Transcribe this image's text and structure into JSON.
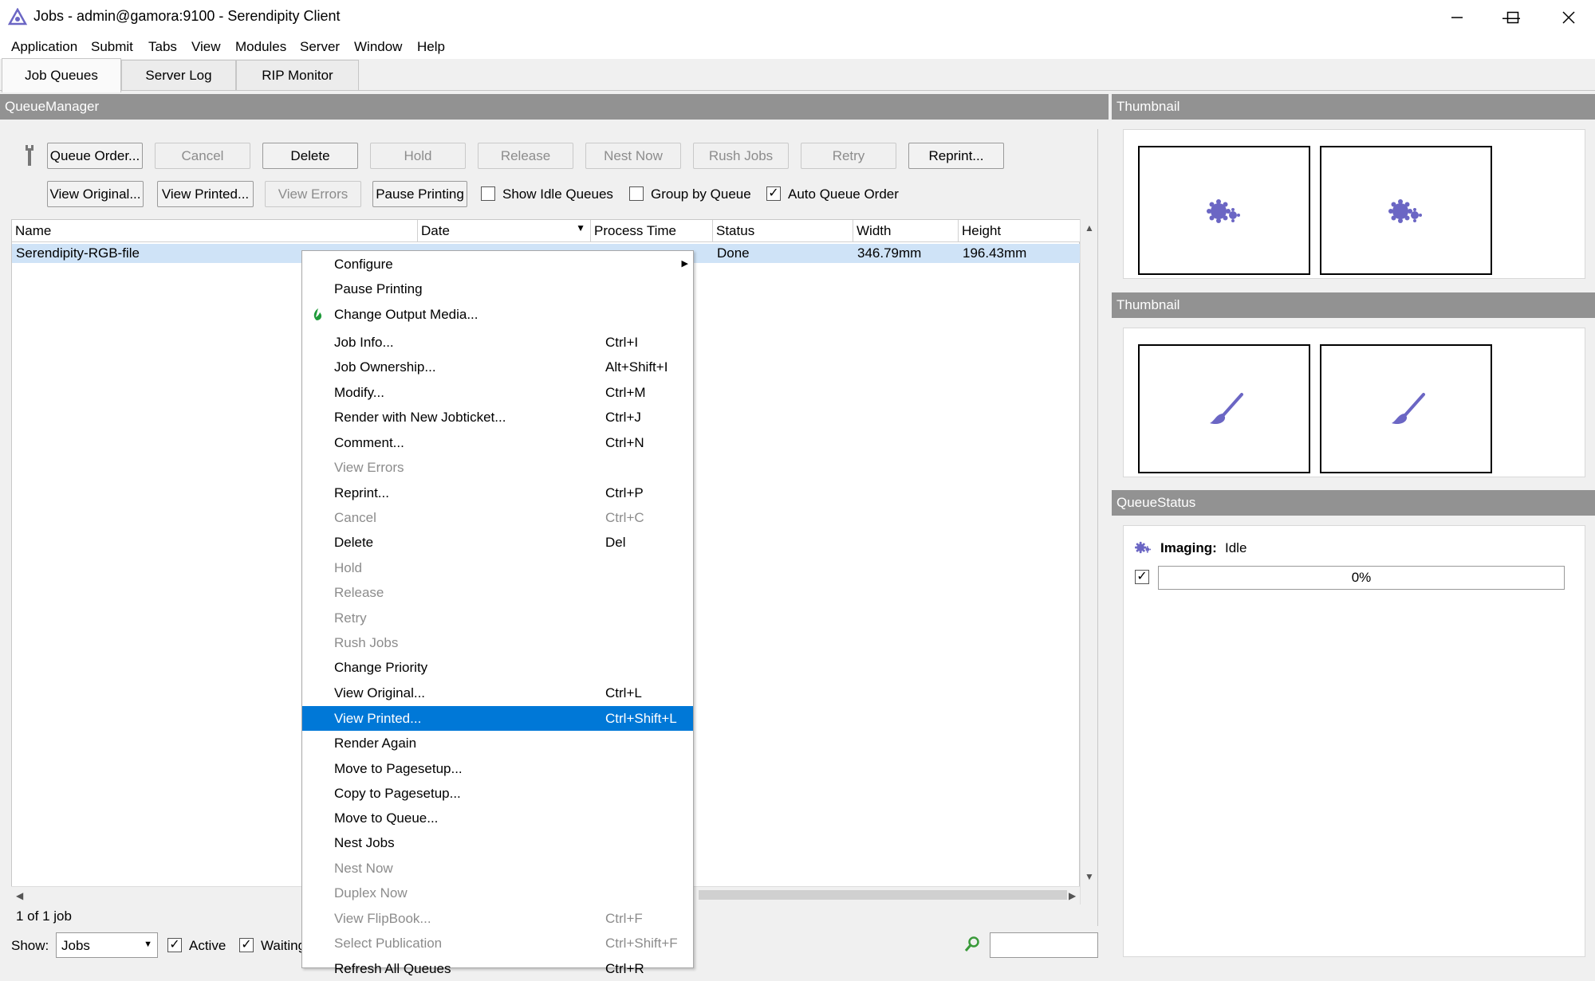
{
  "window": {
    "title": "Jobs - admin@gamora:9100 - Serendipity Client"
  },
  "menubar": [
    "Application",
    "Submit",
    "Tabs",
    "View",
    "Modules",
    "Server",
    "Window",
    "Help"
  ],
  "tabs": [
    "Job Queues",
    "Server Log",
    "RIP Monitor"
  ],
  "queue_manager": {
    "title": "QueueManager",
    "toolbar_row1": [
      {
        "label": "Queue Order...",
        "enabled": true
      },
      {
        "label": "Cancel",
        "enabled": false
      },
      {
        "label": "Delete",
        "enabled": true
      },
      {
        "label": "Hold",
        "enabled": false
      },
      {
        "label": "Release",
        "enabled": false
      },
      {
        "label": "Nest Now",
        "enabled": false
      },
      {
        "label": "Rush Jobs",
        "enabled": false
      },
      {
        "label": "Retry",
        "enabled": false
      },
      {
        "label": "Reprint...",
        "enabled": true
      }
    ],
    "toolbar_row2": [
      {
        "label": "View Original...",
        "enabled": true
      },
      {
        "label": "View Printed...",
        "enabled": true
      },
      {
        "label": "View Errors",
        "enabled": false
      },
      {
        "label": "Pause Printing",
        "enabled": true
      }
    ],
    "options": [
      {
        "label": "Show Idle Queues",
        "checked": false
      },
      {
        "label": "Group by Queue",
        "checked": false
      },
      {
        "label": "Auto Queue Order",
        "checked": true
      }
    ],
    "columns": [
      "Name",
      "Date",
      "Process Time",
      "Status",
      "Width",
      "Height"
    ],
    "rows": [
      {
        "name": "Serendipity-RGB-file",
        "status": "Done",
        "width": "346.79mm",
        "height": "196.43mm"
      }
    ],
    "job_count": "1 of 1 job",
    "show_label": "Show:",
    "show_value": "Jobs",
    "filters": [
      {
        "label": "Active",
        "checked": true
      },
      {
        "label": "Waiting",
        "checked": true
      }
    ]
  },
  "context_menu": [
    {
      "label": "Configure",
      "shortcut": "",
      "enabled": true,
      "submenu": true
    },
    {
      "label": "Pause Printing",
      "shortcut": "",
      "enabled": true
    },
    {
      "label": "Change Output Media...",
      "shortcut": "",
      "enabled": true,
      "icon": "leaf-icon"
    },
    {
      "label": "Job Info...",
      "shortcut": "Ctrl+I",
      "enabled": true
    },
    {
      "label": "Job Ownership...",
      "shortcut": "Alt+Shift+I",
      "enabled": true
    },
    {
      "label": "Modify...",
      "shortcut": "Ctrl+M",
      "enabled": true
    },
    {
      "label": "Render with New Jobticket...",
      "shortcut": "Ctrl+J",
      "enabled": true
    },
    {
      "label": "Comment...",
      "shortcut": "Ctrl+N",
      "enabled": true
    },
    {
      "label": "View Errors",
      "shortcut": "",
      "enabled": false
    },
    {
      "label": "Reprint...",
      "shortcut": "Ctrl+P",
      "enabled": true
    },
    {
      "label": "Cancel",
      "shortcut": "Ctrl+C",
      "enabled": false
    },
    {
      "label": "Delete",
      "shortcut": "Del",
      "enabled": true
    },
    {
      "label": "Hold",
      "shortcut": "",
      "enabled": false
    },
    {
      "label": "Release",
      "shortcut": "",
      "enabled": false
    },
    {
      "label": "Retry",
      "shortcut": "",
      "enabled": false
    },
    {
      "label": "Rush Jobs",
      "shortcut": "",
      "enabled": false
    },
    {
      "label": "Change Priority",
      "shortcut": "",
      "enabled": true
    },
    {
      "label": "View Original...",
      "shortcut": "Ctrl+L",
      "enabled": true
    },
    {
      "label": "View Printed...",
      "shortcut": "Ctrl+Shift+L",
      "enabled": true,
      "selected": true
    },
    {
      "label": "Render Again",
      "shortcut": "",
      "enabled": true
    },
    {
      "label": "Move to Pagesetup...",
      "shortcut": "",
      "enabled": true
    },
    {
      "label": "Copy to Pagesetup...",
      "shortcut": "",
      "enabled": true
    },
    {
      "label": "Move to Queue...",
      "shortcut": "",
      "enabled": true
    },
    {
      "label": "Nest Jobs",
      "shortcut": "",
      "enabled": true
    },
    {
      "label": "Nest Now",
      "shortcut": "",
      "enabled": false
    },
    {
      "label": "Duplex Now",
      "shortcut": "",
      "enabled": false
    },
    {
      "label": "View FlipBook...",
      "shortcut": "Ctrl+F",
      "enabled": false
    },
    {
      "label": "Select Publication",
      "shortcut": "Ctrl+Shift+F",
      "enabled": false
    },
    {
      "label": "Refresh All Queues",
      "shortcut": "Ctrl+R",
      "enabled": true
    }
  ],
  "thumbnail_panels": [
    {
      "title": "Thumbnail",
      "icon": "gear-icon"
    },
    {
      "title": "Thumbnail",
      "icon": "brush-icon"
    }
  ],
  "queue_status": {
    "title": "QueueStatus",
    "label": "Imaging:",
    "state": "Idle",
    "progress_text": "0%",
    "progress": 0,
    "checked": true
  },
  "colors": {
    "selection": "#0078d7",
    "panel_header": "#929292",
    "icon": "#6b66c4",
    "row_selected": "#cfe3f7"
  }
}
